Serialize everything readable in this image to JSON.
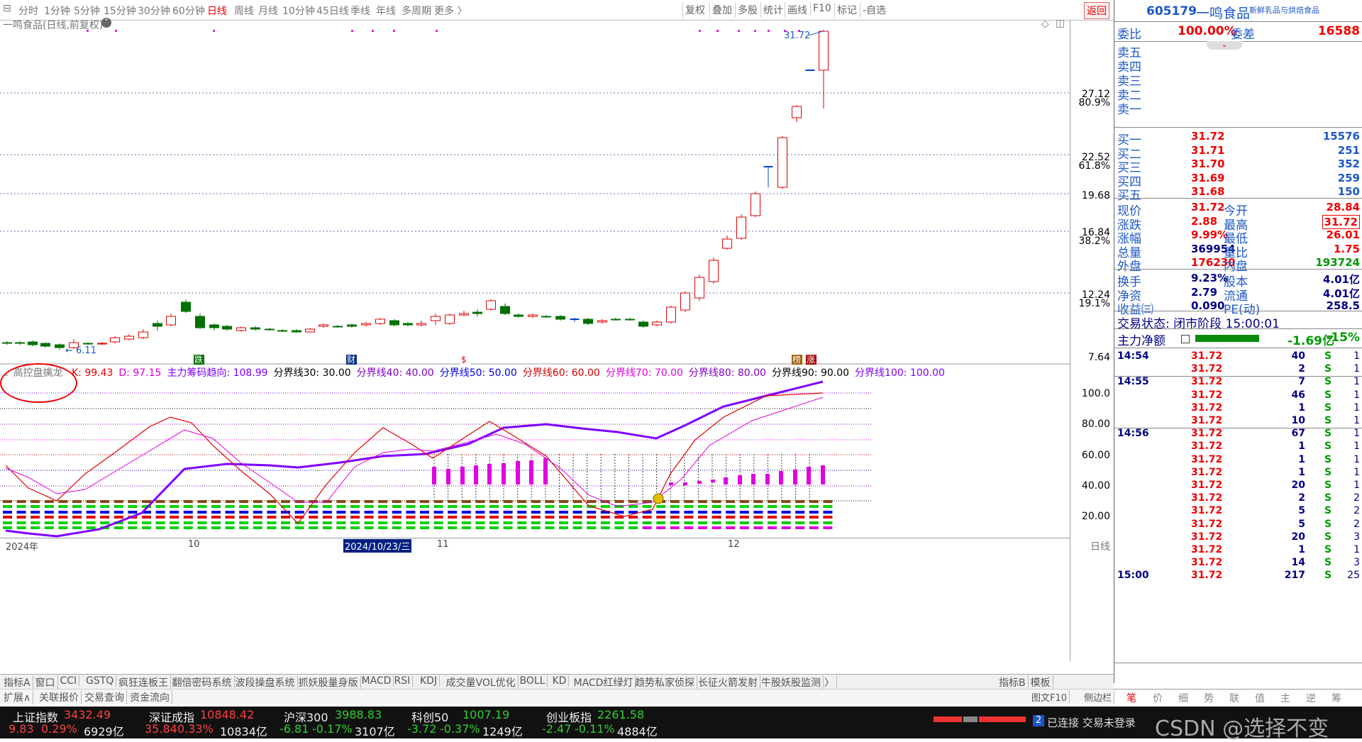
{
  "toolbar": {
    "periods": [
      "分时",
      "1分钟",
      "5分钟",
      "15分钟",
      "30分钟",
      "60分钟",
      "日线",
      "周线",
      "月线",
      "10分钟",
      "45日线",
      "季线",
      "年线",
      "多周期",
      "更多 〉"
    ],
    "active_period": "日线",
    "right_items": [
      "复权",
      "叠加",
      "多股",
      "统计",
      "画线",
      "F10",
      "标记",
      "-自选"
    ],
    "back_label": "返回"
  },
  "chart": {
    "title": "一鸣食品(日线,前复权)",
    "price_axis": [
      "27.12",
      "80.9%",
      "22.52",
      "61.8%",
      "19.68",
      "16.84",
      "38.2%",
      "12.24",
      "19.1%",
      "7.64"
    ],
    "high_label": "31.72",
    "low_label": "6.11",
    "event_markers": [
      "跌",
      "财",
      "$",
      "榜",
      "涨"
    ],
    "indicator_name": "高控盘擒龙",
    "indicator_values": [
      {
        "label": "K: 99.43",
        "color": "#e00000"
      },
      {
        "label": "D: 97.15",
        "color": "#e000e0"
      },
      {
        "label": "主力筹码趋向: 108.99",
        "color": "#8000ff"
      },
      {
        "label": "分界线30: 30.00",
        "color": "#000000"
      },
      {
        "label": "分界线40: 40.00",
        "color": "#8000c0"
      },
      {
        "label": "分界线50: 50.00",
        "color": "#0000e0"
      },
      {
        "label": "分界线60: 60.00",
        "color": "#d00000"
      },
      {
        "label": "分界线70: 70.00",
        "color": "#e000e0"
      },
      {
        "label": "分界线80: 80.00",
        "color": "#8000c0"
      },
      {
        "label": "分界线90: 90.00",
        "color": "#000000"
      },
      {
        "label": "分界线100: 100.00",
        "color": "#8000ff"
      }
    ],
    "indicator_axis": [
      "100.0",
      "80.00",
      "60.00",
      "40.00",
      "20.00"
    ],
    "date_labels": [
      "2024年",
      "10",
      "2024/10/23/三",
      "11",
      "12"
    ],
    "period_label": "日线"
  },
  "quote": {
    "code": "605179",
    "name": "一鸣食品",
    "tag": "新鲜乳品与烘焙食品",
    "weibi_label": "委比",
    "weibi_value": "100.00%",
    "weicha_label": "委差",
    "weicha_value": "16588",
    "sells": [
      "卖五",
      "卖四",
      "卖三",
      "卖二",
      "卖一"
    ],
    "buys": [
      {
        "label": "买一",
        "price": "31.72",
        "vol": "15576"
      },
      {
        "label": "买二",
        "price": "31.71",
        "vol": "251"
      },
      {
        "label": "买三",
        "price": "31.70",
        "vol": "352"
      },
      {
        "label": "买四",
        "price": "31.69",
        "vol": "259"
      },
      {
        "label": "买五",
        "price": "31.68",
        "vol": "150"
      }
    ],
    "stats": [
      {
        "l1": "现价",
        "v1": "31.72",
        "c1": "red",
        "l2": "今开",
        "v2": "28.84",
        "c2": "red"
      },
      {
        "l1": "涨跌",
        "v1": "2.88",
        "c1": "red",
        "l2": "最高",
        "v2": "31.72",
        "c2": "red"
      },
      {
        "l1": "涨幅",
        "v1": "9.99%",
        "c1": "red",
        "l2": "最低",
        "v2": "26.01",
        "c2": "red"
      },
      {
        "l1": "总量",
        "v1": "369954",
        "c1": "navy",
        "l2": "量比",
        "v2": "1.75",
        "c2": "red"
      },
      {
        "l1": "外盘",
        "v1": "176230",
        "c1": "red",
        "l2": "内盘",
        "v2": "193724",
        "c2": "green"
      }
    ],
    "stats2": [
      {
        "l1": "换手",
        "v1": "9.23%",
        "l2": "股本",
        "v2": "4.01亿"
      },
      {
        "l1": "净资",
        "v1": "2.79",
        "l2": "流通",
        "v2": "4.01亿"
      },
      {
        "l1": "收益㈢",
        "v1": "0.090",
        "l2": "PE(动)",
        "v2": "258.5"
      }
    ],
    "trade_status": "交易状态: 闭市阶段 15:00:01",
    "net_label": "主力净额",
    "net_value": "-1.69亿",
    "net_pct": "-15%"
  },
  "ticks": [
    {
      "time": "14:54",
      "price": "31.72",
      "vol": "40",
      "bs": "S",
      "n": "1"
    },
    {
      "time": "",
      "price": "31.72",
      "vol": "2",
      "bs": "S",
      "n": "1"
    },
    {
      "time": "14:55",
      "price": "31.72",
      "vol": "7",
      "bs": "S",
      "n": "1"
    },
    {
      "time": "",
      "price": "31.72",
      "vol": "46",
      "bs": "S",
      "n": "1"
    },
    {
      "time": "",
      "price": "31.72",
      "vol": "1",
      "bs": "S",
      "n": "1"
    },
    {
      "time": "",
      "price": "31.72",
      "vol": "10",
      "bs": "S",
      "n": "1"
    },
    {
      "time": "14:56",
      "price": "31.72",
      "vol": "67",
      "bs": "S",
      "n": "1"
    },
    {
      "time": "",
      "price": "31.72",
      "vol": "1",
      "bs": "S",
      "n": "1"
    },
    {
      "time": "",
      "price": "31.72",
      "vol": "1",
      "bs": "S",
      "n": "1"
    },
    {
      "time": "",
      "price": "31.72",
      "vol": "1",
      "bs": "S",
      "n": "1"
    },
    {
      "time": "",
      "price": "31.72",
      "vol": "20",
      "bs": "S",
      "n": "1"
    },
    {
      "time": "",
      "price": "31.72",
      "vol": "2",
      "bs": "S",
      "n": "2"
    },
    {
      "time": "",
      "price": "31.72",
      "vol": "5",
      "bs": "S",
      "n": "2"
    },
    {
      "time": "",
      "price": "31.72",
      "vol": "5",
      "bs": "S",
      "n": "2"
    },
    {
      "time": "",
      "price": "31.72",
      "vol": "20",
      "bs": "S",
      "n": "3"
    },
    {
      "time": "",
      "price": "31.72",
      "vol": "1",
      "bs": "S",
      "n": "1"
    },
    {
      "time": "",
      "price": "31.72",
      "vol": "14",
      "bs": "S",
      "n": "3"
    },
    {
      "time": "15:00",
      "price": "31.72",
      "vol": "217",
      "bs": "S",
      "n": "25"
    }
  ],
  "tabs1": [
    "指标A",
    "窗口",
    "CCI",
    "GSTQ",
    "疯狂连板王",
    "翻倍密码系统",
    "波段操盘系统",
    "抓妖股量身版",
    "MACD",
    "RSI",
    "KDJ",
    "成交量VOL优化",
    "BOLL",
    "KD",
    "MACD红绿灯",
    "趋势私家侦探",
    "长征火箭发射",
    "牛股妖股监测",
    "〉",
    "指标B",
    "模板"
  ],
  "tabs2": [
    "扩展∧",
    "关联报价",
    "交易查询",
    "资金流向"
  ],
  "rtabs": [
    "图文F10",
    "侧边栏",
    "笔",
    "价",
    "细",
    "势",
    "联",
    "值",
    "主",
    "逆",
    "筹"
  ],
  "status": {
    "indices": [
      {
        "name": "上证指数",
        "value": "3432.49",
        "chg": "9.83",
        "pct": "0.29%",
        "amt": "6929亿",
        "color": "#ff4040"
      },
      {
        "name": "深证成指",
        "value": "10848.42",
        "chg": "35.84",
        "pct": "0.33%",
        "amt": "10834亿",
        "color": "#ff4040"
      },
      {
        "name": "沪深300",
        "value": "3988.83",
        "chg": "-6.81",
        "pct": "-0.17%",
        "amt": "3107亿",
        "color": "#30d030"
      },
      {
        "name": "科创50",
        "value": "1007.19",
        "chg": "-3.72",
        "pct": "-0.37%",
        "amt": "1249亿",
        "color": "#30d030"
      },
      {
        "name": "创业板指",
        "value": "2261.58",
        "chg": "-2.47",
        "pct": "-0.11%",
        "amt": "4884亿",
        "color": "#30d030"
      }
    ],
    "connect": "已连接 交易未登录",
    "watermark": "CSDN @选择不变"
  }
}
